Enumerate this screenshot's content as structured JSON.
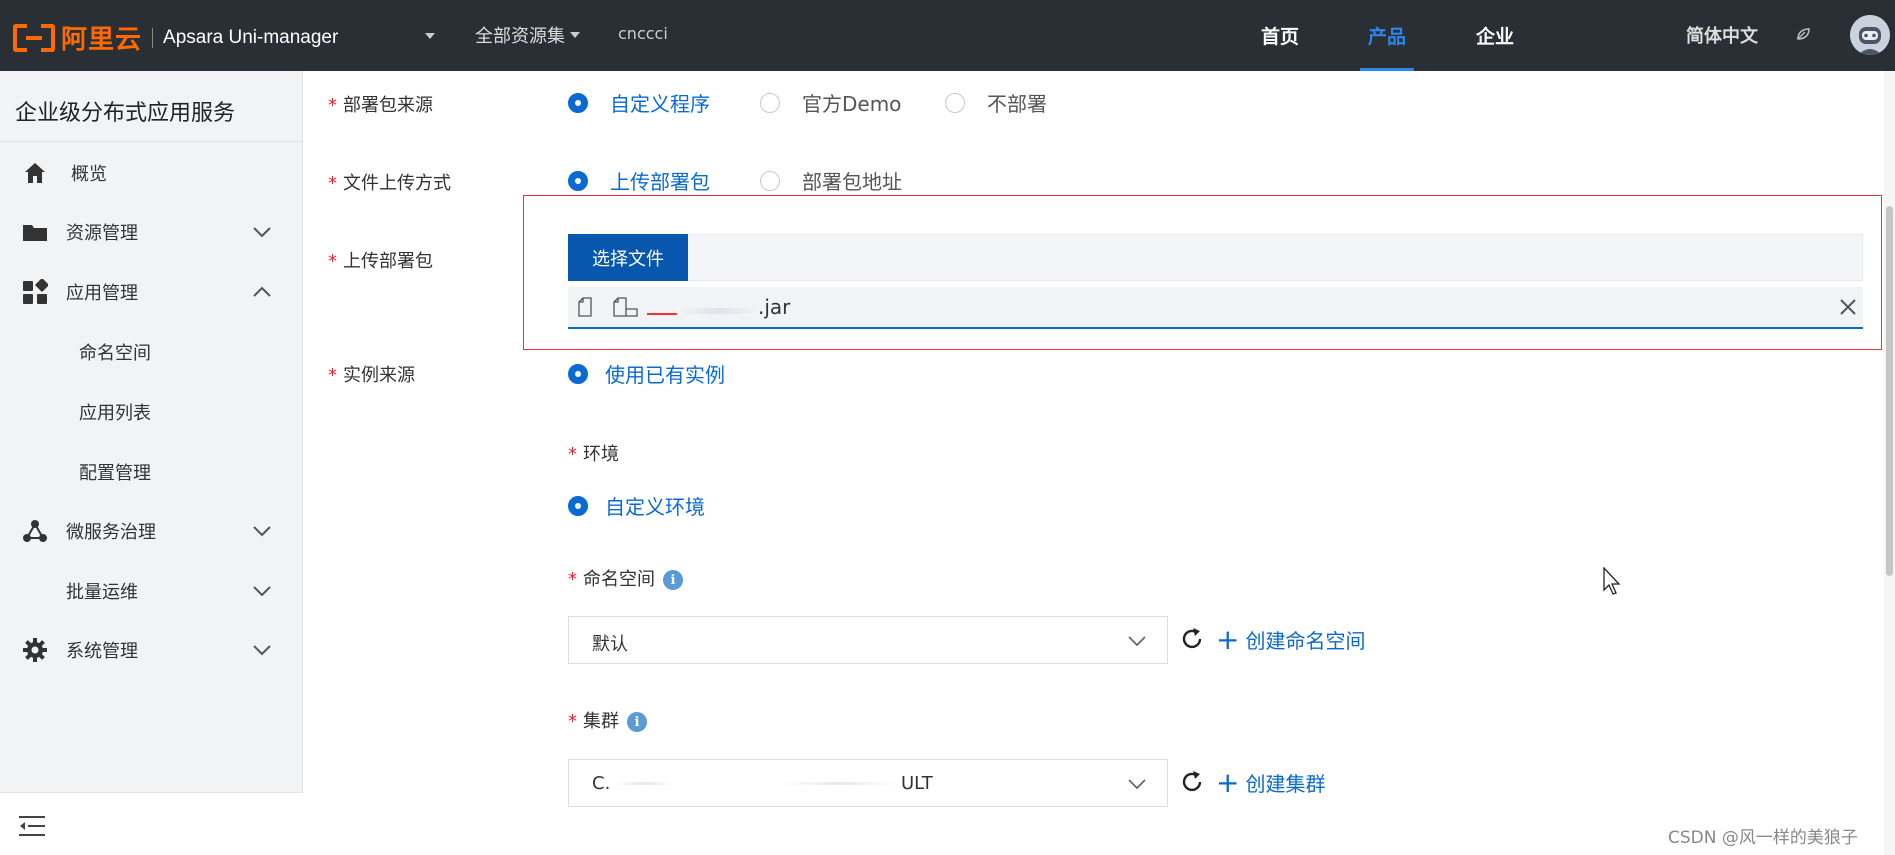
{
  "topbar": {
    "logo_text": "阿里云",
    "app_name": "Apsara Uni-manager",
    "resource_set": "全部资源集",
    "region": "cnccci",
    "nav": [
      {
        "label": "首页",
        "active": false
      },
      {
        "label": "产品",
        "active": true
      },
      {
        "label": "企业",
        "active": false
      }
    ],
    "language": "简体中文"
  },
  "sidebar": {
    "title": "企业级分布式应用服务",
    "items": [
      {
        "label": "概览",
        "icon": "home-icon",
        "expandable": false
      },
      {
        "label": "资源管理",
        "icon": "folder-icon",
        "expandable": true,
        "expanded": false
      },
      {
        "label": "应用管理",
        "icon": "apps-icon",
        "expandable": true,
        "expanded": true
      },
      {
        "label": "命名空间",
        "sub": true
      },
      {
        "label": "应用列表",
        "sub": true
      },
      {
        "label": "配置管理",
        "sub": true
      },
      {
        "label": "微服务治理",
        "icon": "network-icon",
        "expandable": true,
        "expanded": false
      },
      {
        "label": "批量运维",
        "icon": "",
        "expandable": true,
        "expanded": false
      },
      {
        "label": "系统管理",
        "icon": "gear-icon",
        "expandable": true,
        "expanded": false
      }
    ]
  },
  "form": {
    "package_source": {
      "label": "部署包来源",
      "options": [
        "自定义程序",
        "官方Demo",
        "不部署"
      ],
      "selected": 0
    },
    "upload_method": {
      "label": "文件上传方式",
      "options": [
        "上传部署包",
        "部署包地址"
      ],
      "selected": 0
    },
    "upload_package": {
      "label": "上传部署包",
      "button": "选择文件",
      "file_name": ".jar"
    },
    "instance_source": {
      "label": "实例来源",
      "options": [
        "使用已有实例"
      ],
      "selected": 0
    },
    "environment": {
      "label": "环境",
      "options": [
        "自定义环境"
      ],
      "selected": 0
    },
    "namespace": {
      "label": "命名空间",
      "value": "默认",
      "create_link": "创建命名空间"
    },
    "cluster": {
      "label": "集群",
      "value_start": "C.",
      "value_end": "ULT",
      "create_link": "创建集群"
    }
  },
  "watermark": "CSDN @风一样的美狼子",
  "colors": {
    "accent": "#0b6ad1",
    "brand": "#ff6a00",
    "topbar": "#2a2f35",
    "required": "#e23333"
  }
}
